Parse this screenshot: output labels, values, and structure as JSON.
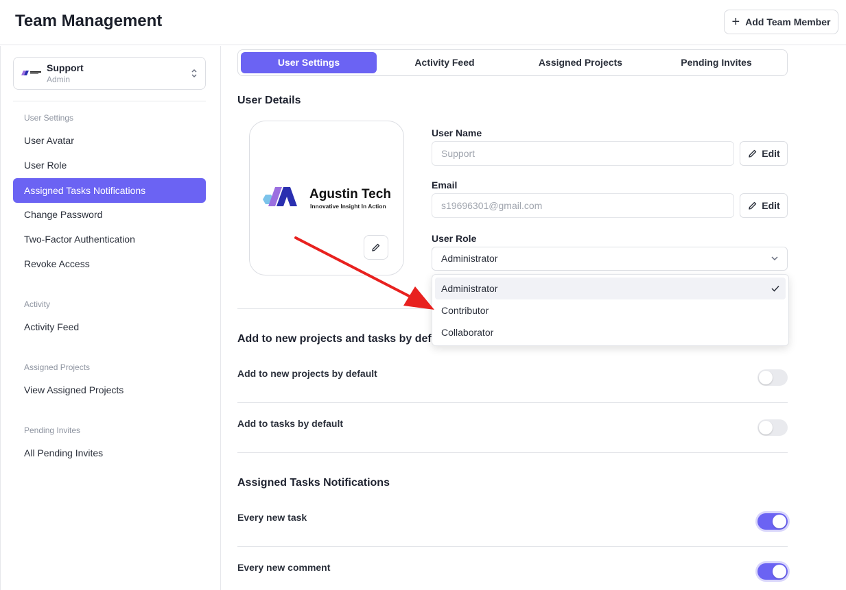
{
  "header": {
    "title": "Team Management",
    "add_member_label": "Add Team Member"
  },
  "workspace": {
    "name": "Support",
    "role": "Admin"
  },
  "sidebar": {
    "sections": [
      {
        "title": "User Settings",
        "items": [
          "User Avatar",
          "User Role",
          "Assigned Tasks Notifications",
          "Change Password",
          "Two-Factor Authentication",
          "Revoke Access"
        ]
      },
      {
        "title": "Activity",
        "items": [
          "Activity Feed"
        ]
      },
      {
        "title": "Assigned Projects",
        "items": [
          "View Assigned Projects"
        ]
      },
      {
        "title": "Pending Invites",
        "items": [
          "All Pending Invites"
        ]
      }
    ],
    "active_item": "Assigned Tasks Notifications"
  },
  "tabs": [
    "User Settings",
    "Activity Feed",
    "Assigned Projects",
    "Pending Invites"
  ],
  "active_tab": "User Settings",
  "user_details": {
    "title": "User Details",
    "avatar": {
      "brand": "Agustin Tech",
      "tagline": "Innovative Insight In Action"
    },
    "user_name": {
      "label": "User Name",
      "placeholder": "Support"
    },
    "email": {
      "label": "Email",
      "placeholder": "s19696301@gmail.com"
    },
    "edit_label": "Edit",
    "role": {
      "label": "User Role",
      "value": "Administrator",
      "options": [
        "Administrator",
        "Contributor",
        "Collaborator"
      ],
      "selected": "Administrator"
    }
  },
  "defaults": {
    "title": "Add to new projects and tasks by default",
    "toggles": [
      {
        "label": "Add to new projects by default",
        "on": false
      },
      {
        "label": "Add to tasks by default",
        "on": false
      }
    ]
  },
  "notifications": {
    "title": "Assigned Tasks Notifications",
    "toggles": [
      {
        "label": "Every new task",
        "on": true
      },
      {
        "label": "Every new comment",
        "on": true
      }
    ]
  },
  "colors": {
    "accent": "#6b63f3",
    "annotation_arrow": "#e8211f"
  }
}
